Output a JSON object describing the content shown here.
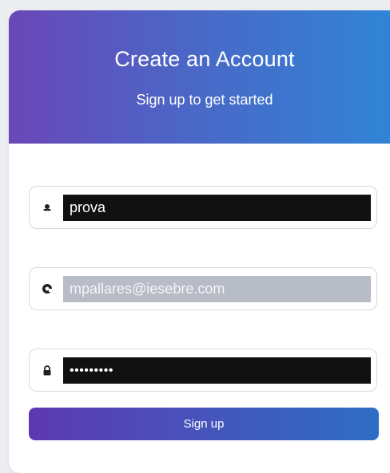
{
  "header": {
    "title": "Create an Account",
    "subtitle": "Sign up to get started"
  },
  "form": {
    "username": {
      "icon": "user-icon",
      "value": "prova"
    },
    "email": {
      "icon": "at-sign-icon",
      "value": "mpallares@iesebre.com"
    },
    "password": {
      "icon": "lock-icon",
      "value": "•••••••••"
    },
    "submit_label": "Sign up"
  },
  "colors": {
    "header_gradient_start": "#6a47b8",
    "header_gradient_end": "#2f86d6",
    "button_gradient_start": "#5d38b2",
    "button_gradient_end": "#2e6ec4"
  }
}
